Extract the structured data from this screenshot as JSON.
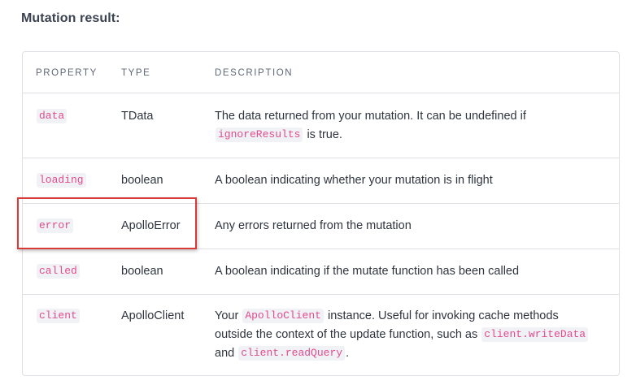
{
  "section_title": "Mutation result:",
  "table": {
    "headers": {
      "property": "PROPERTY",
      "type": "TYPE",
      "description": "DESCRIPTION"
    },
    "rows": [
      {
        "property": "data",
        "type": "TData",
        "desc_parts": [
          "The data returned from your mutation. It can be undefined if ",
          "ignoreResults",
          " is true."
        ]
      },
      {
        "property": "loading",
        "type": "boolean",
        "desc_parts": [
          "A boolean indicating whether your mutation is in flight"
        ]
      },
      {
        "property": "error",
        "type": "ApolloError",
        "desc_parts": [
          "Any errors returned from the mutation"
        ]
      },
      {
        "property": "called",
        "type": "boolean",
        "desc_parts": [
          "A boolean indicating if the mutate function has been called"
        ]
      },
      {
        "property": "client",
        "type": "ApolloClient",
        "desc_parts": [
          "Your ",
          "ApolloClient",
          " instance. Useful for invoking cache methods outside the context of the update function, such as ",
          "client.writeData",
          " and ",
          "client.readQuery",
          "."
        ]
      }
    ]
  },
  "colors": {
    "code_text": "#e24c8e",
    "code_bg": "#f0f2f5",
    "border": "#dde1e6",
    "highlight": "#d83a3a"
  }
}
